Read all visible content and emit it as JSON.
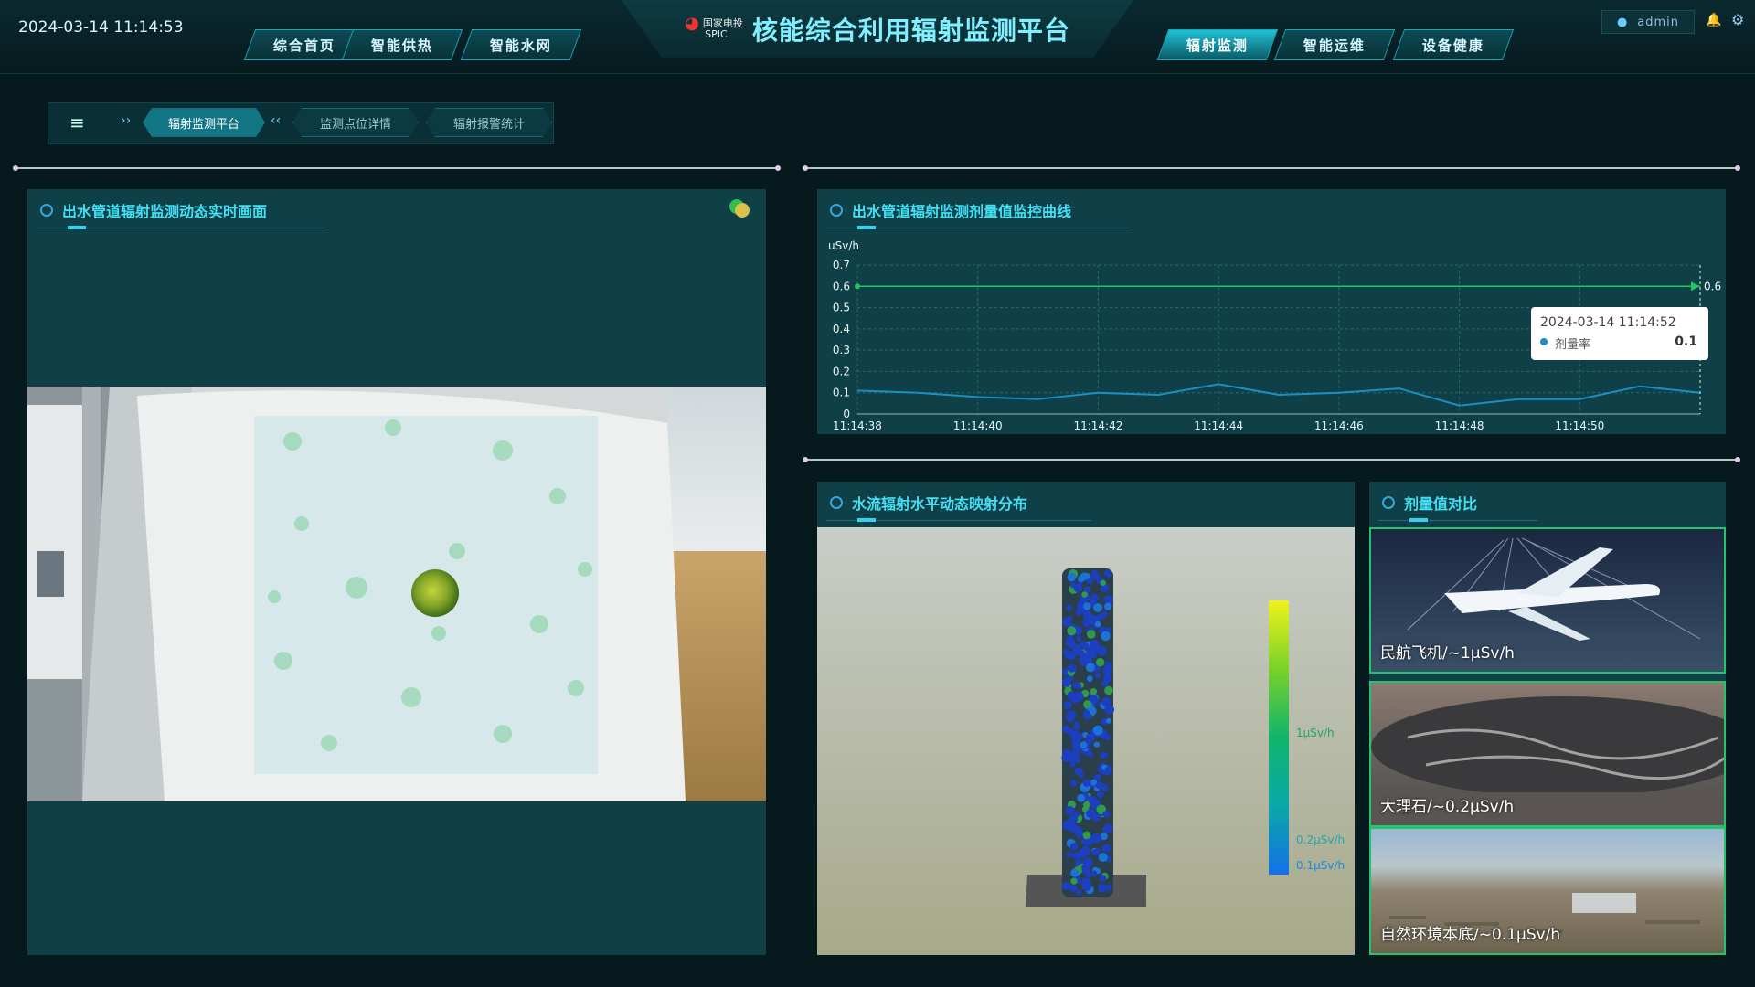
{
  "header": {
    "datetime": "2024-03-14 11:14:53",
    "title": "核能综合利用辐射监测平台",
    "logo_cn": "国家电投",
    "logo_en": "SPIC",
    "user": "admin",
    "nav_left": [
      "综合首页",
      "智能供热",
      "智能水网"
    ],
    "nav_right": [
      "辐射监测",
      "智能运维",
      "设备健康"
    ],
    "active_nav": "辐射监测"
  },
  "breadcrumb": {
    "items": [
      "辐射监测平台",
      "监测点位详情",
      "辐射报警统计"
    ],
    "active": "辐射监测平台"
  },
  "panels": {
    "camera_title": "出水管道辐射监测动态实时画面",
    "chart_title": "出水管道辐射监测剂量值监控曲线",
    "flow_title": "水流辐射水平动态映射分布",
    "compare_title": "剂量值对比"
  },
  "chart_data": {
    "type": "line",
    "ylabel": "uSv/h",
    "ylim": [
      0,
      0.7
    ],
    "yticks": [
      "0",
      "0.1",
      "0.2",
      "0.3",
      "0.4",
      "0.5",
      "0.6",
      "0.7"
    ],
    "xticks": [
      "11:14:38",
      "11:14:40",
      "11:14:42",
      "11:14:44",
      "11:14:46",
      "11:14:48",
      "11:14:50"
    ],
    "threshold": 0.6,
    "threshold_label": "0.6",
    "series": [
      {
        "name": "剂量率",
        "x": [
          "11:14:38",
          "11:14:39",
          "11:14:40",
          "11:14:41",
          "11:14:42",
          "11:14:43",
          "11:14:44",
          "11:14:45",
          "11:14:46",
          "11:14:47",
          "11:14:48",
          "11:14:49",
          "11:14:50",
          "11:14:51",
          "11:14:52"
        ],
        "values": [
          0.11,
          0.1,
          0.08,
          0.07,
          0.1,
          0.09,
          0.14,
          0.09,
          0.1,
          0.12,
          0.04,
          0.07,
          0.07,
          0.13,
          0.1
        ]
      }
    ],
    "tooltip": {
      "time": "2024-03-14 11:14:52",
      "label": "剂量率",
      "value": "0.1"
    }
  },
  "colorbar": {
    "labels": [
      "1μSv/h",
      "0.2μSv/h",
      "0.1μSv/h"
    ]
  },
  "comparison": [
    {
      "label": "民航飞机/~1μSv/h"
    },
    {
      "label": "大理石/~0.2μSv/h"
    },
    {
      "label": "自然环境本底/~0.1μSv/h"
    }
  ],
  "colors": {
    "accent": "#31d3ee",
    "line": "#1a8fc0",
    "threshold": "#22c55e"
  }
}
